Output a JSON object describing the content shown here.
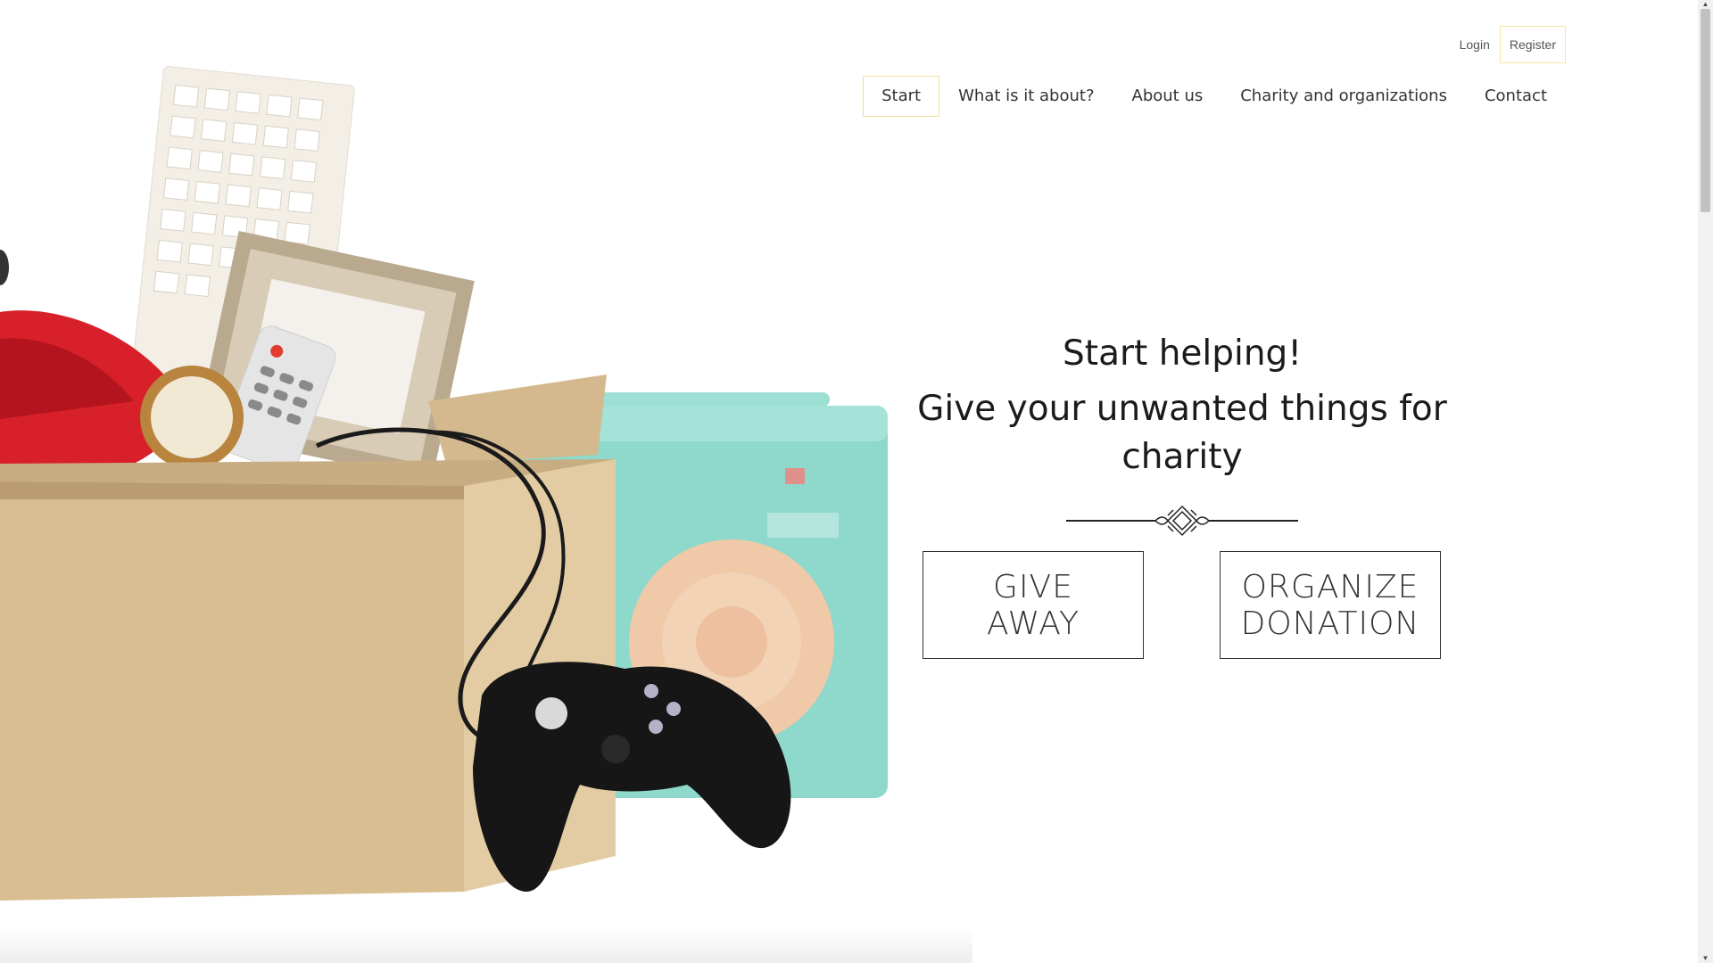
{
  "auth": {
    "login_label": "Login",
    "register_label": "Register"
  },
  "nav": {
    "items": [
      {
        "label": "Start",
        "active": true
      },
      {
        "label": "What is it about?",
        "active": false
      },
      {
        "label": "About us",
        "active": false
      },
      {
        "label": "Charity and organizations",
        "active": false
      },
      {
        "label": "Contact",
        "active": false
      }
    ]
  },
  "hero": {
    "title": "Start helping!",
    "subtitle": "Give your unwanted things for charity",
    "ornament_icon": "decorative-divider-icon"
  },
  "cta": {
    "give_away": [
      "GIVE",
      "AWAY"
    ],
    "organize_donation": [
      "ORGANIZE",
      "DONATION"
    ]
  },
  "colors": {
    "active_border": "#eee19a",
    "text": "#333333",
    "cta_border": "#333333"
  },
  "icons": {
    "scroll_up": "scroll-up-arrow-icon",
    "scroll_down": "scroll-down-arrow-icon"
  }
}
